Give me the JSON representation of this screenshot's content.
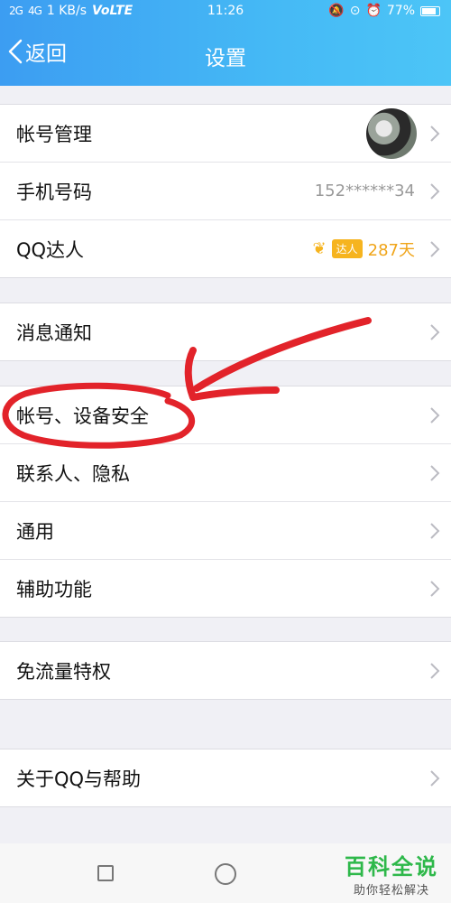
{
  "status_bar": {
    "signal1": "2G",
    "signal2": "4G",
    "speed": "1 KB/s",
    "network": "VoLTE",
    "time": "11:26",
    "battery": "77%",
    "battery_level": 0.77
  },
  "header": {
    "back_label": "返回",
    "title": "设置"
  },
  "groups": [
    {
      "items": [
        {
          "label": "帐号管理",
          "extra": "avatar"
        },
        {
          "label": "手机号码",
          "value": "152******34"
        },
        {
          "label": "QQ达人",
          "badge": "达人",
          "days": "287天"
        }
      ]
    },
    {
      "items": [
        {
          "label": "消息通知"
        }
      ]
    },
    {
      "items": [
        {
          "label": "帐号、设备安全"
        },
        {
          "label": "联系人、隐私"
        },
        {
          "label": "通用"
        },
        {
          "label": "辅助功能"
        }
      ]
    },
    {
      "items": [
        {
          "label": "免流量特权"
        }
      ]
    },
    {
      "items": [
        {
          "label": "关于QQ与帮助"
        }
      ]
    }
  ],
  "watermark": {
    "title": "百科全说",
    "subtitle": "助你轻松解决"
  },
  "colors": {
    "header_start": "#3c9df2",
    "header_end": "#4cc5f7",
    "accent_gold": "#f0a51a",
    "annotation_red": "#e2232a",
    "watermark_green": "#2eb84a"
  }
}
